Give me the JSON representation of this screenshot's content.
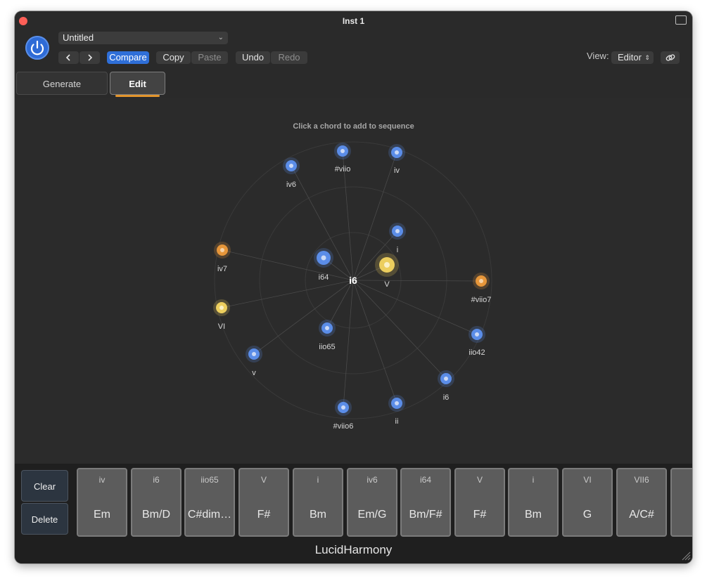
{
  "window": {
    "title": "Inst 1"
  },
  "toolbar": {
    "preset": "Untitled",
    "compare": "Compare",
    "copy": "Copy",
    "paste": "Paste",
    "undo": "Undo",
    "redo": "Redo",
    "view_label": "View:",
    "view_value": "Editor"
  },
  "tabs": [
    {
      "label": "Generate"
    },
    {
      "label": "Edit"
    }
  ],
  "active_tab": "Edit",
  "editor": {
    "hint": "Click a chord to add to sequence",
    "current_chord": "i6",
    "nodes": [
      {
        "label": "#viio",
        "kind": "blue"
      },
      {
        "label": "iv",
        "kind": "blue"
      },
      {
        "label": "iv6",
        "kind": "blue"
      },
      {
        "label": "i",
        "kind": "blue"
      },
      {
        "label": "iv7",
        "kind": "orange"
      },
      {
        "label": "i64",
        "kind": "blue"
      },
      {
        "label": "V",
        "kind": "yellow"
      },
      {
        "label": "#viio7",
        "kind": "orange"
      },
      {
        "label": "VI",
        "kind": "yellow"
      },
      {
        "label": "iio65",
        "kind": "blue"
      },
      {
        "label": "iio42",
        "kind": "blue"
      },
      {
        "label": "v",
        "kind": "blue"
      },
      {
        "label": "i6",
        "kind": "blue"
      },
      {
        "label": "ii",
        "kind": "blue"
      },
      {
        "label": "#viio6",
        "kind": "blue"
      }
    ]
  },
  "sequence": {
    "clear": "Clear",
    "delete": "Delete",
    "chords": [
      {
        "numeral": "iv",
        "name": "Em"
      },
      {
        "numeral": "i6",
        "name": "Bm/D"
      },
      {
        "numeral": "iio65",
        "name": "C#dim…"
      },
      {
        "numeral": "V",
        "name": "F#"
      },
      {
        "numeral": "i",
        "name": "Bm"
      },
      {
        "numeral": "iv6",
        "name": "Em/G"
      },
      {
        "numeral": "i64",
        "name": "Bm/F#"
      },
      {
        "numeral": "V",
        "name": "F#"
      },
      {
        "numeral": "i",
        "name": "Bm"
      },
      {
        "numeral": "VI",
        "name": "G"
      },
      {
        "numeral": "VII6",
        "name": "A/C#"
      }
    ]
  },
  "brand": "LucidHarmony",
  "colors": {
    "blue_node": "#5b8de8",
    "orange_node": "#e6963a",
    "yellow_node": "#ecce5e",
    "accent": "#2f6fd8",
    "tab_underline": "#e3952c"
  }
}
